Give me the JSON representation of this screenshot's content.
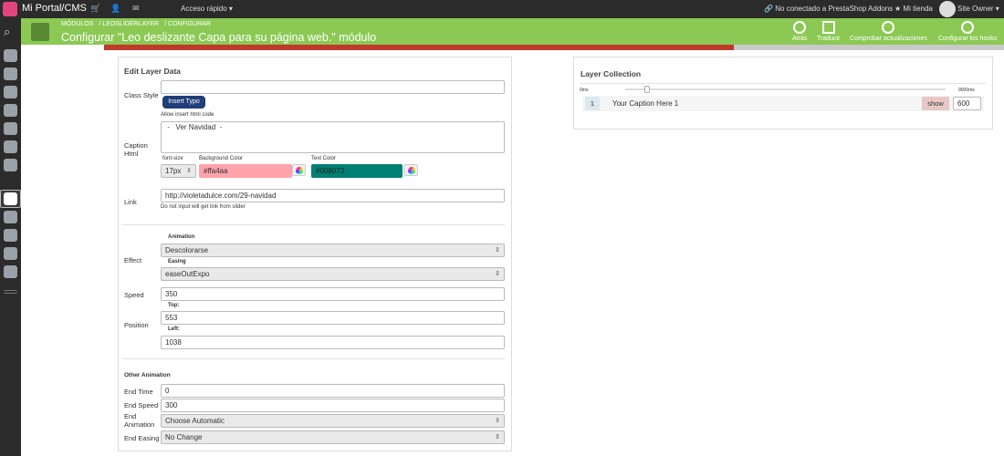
{
  "topbar": {
    "brand": "Mi Portal/CMS",
    "quick_access": "Acceso rápido ▾",
    "addons_status": "No conectado a PrestaShop Addons",
    "my_store": "Mi tienda",
    "user": "Site Owner ▾"
  },
  "header": {
    "breadcrumbs": [
      "MÓDULOS",
      "LEOSLIDERLAYER",
      "CONFIGURAR"
    ],
    "title": "Configurar \"Leo deslizante Capa para su página web.\" módulo",
    "buttons": {
      "back": "Atrás",
      "translate": "Traducir",
      "check_updates": "Comprobar actualizaciones",
      "hooks": "Configurar los hooks"
    }
  },
  "progress": {
    "value": 0.7
  },
  "edit_layer": {
    "title": "Edit Layer Data",
    "class_style_label": "Class Style",
    "class_style_value": "",
    "insert_typo_label": "Insert Typo",
    "allow_html_note": "Allow insert html code",
    "caption_label": "Caption Html",
    "caption_value": " -   Ver Navidad  - ",
    "font_size_label": "font-size",
    "font_size_value": "17px",
    "bg_color_label": "Background Color",
    "bg_color_value": "#ffa4aa",
    "text_color_label": "Text Color",
    "text_color_value": "#008073",
    "link_label": "Link",
    "link_value": "http://violetadulce.com/29-navidad",
    "link_note": "Do not input will get link from slider",
    "animation_label": "Animation",
    "effect_label": "Effect",
    "animation_value": "Descolorarse",
    "easing_label": "Easing",
    "easing_value": "easeOutExpo",
    "speed_label": "Speed",
    "speed_value": "350",
    "top_label": "Top:",
    "position_label": "Position",
    "top_value": "553",
    "left_label": "Left:",
    "left_value": "1038",
    "other_animation_title": "Other Animation",
    "end_time_label": "End Time",
    "end_time_value": "0",
    "end_speed_label": "End Speed",
    "end_speed_value": "300",
    "end_animation_label": "End Animation",
    "end_animation_value": "Choose Automatic",
    "end_easing_label": "End Easing",
    "end_easing_value": "No Change"
  },
  "layer_collection": {
    "title": "Layer Collection",
    "slider_min": "0ms",
    "slider_max": "9000ms",
    "slider_position": 0.06,
    "layer_index": "1",
    "layer_caption": "Your Caption Here 1",
    "show_label": "show",
    "layer_time": "600"
  },
  "colors": {
    "header_green": "#8bc954",
    "topbar_dark": "#2b2b2b",
    "insert_typo_blue": "#1f3e7a",
    "bg_swatch": "#ffa4aa",
    "text_swatch": "#008073",
    "progress_red": "#c0392b"
  }
}
